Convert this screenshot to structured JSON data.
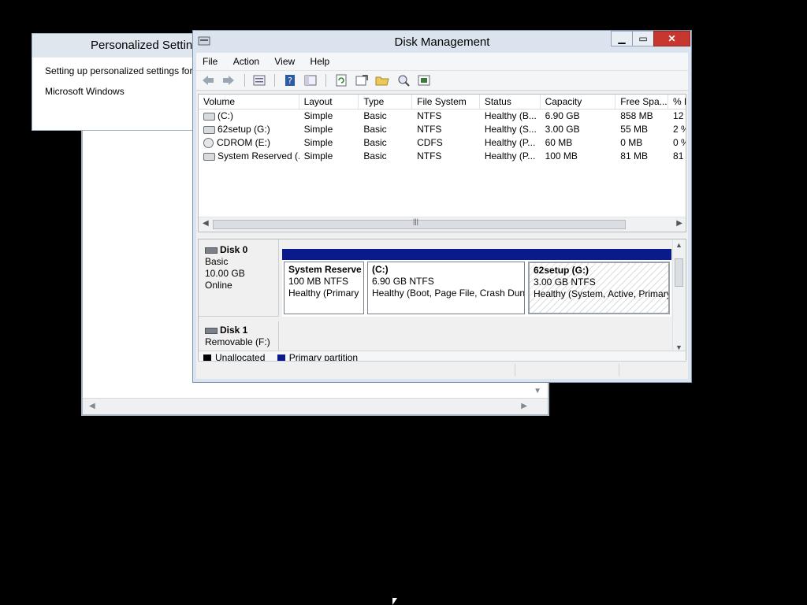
{
  "personalized": {
    "title": "Personalized Settings",
    "line1": "Setting up personalized settings for:",
    "line2": "Microsoft Windows"
  },
  "window": {
    "title": "Disk Management",
    "minimize_icon": "minimize-icon",
    "maximize_icon": "maximize-icon",
    "close_icon": "close-icon"
  },
  "menu": [
    "File",
    "Action",
    "View",
    "Help"
  ],
  "toolbar": [
    "back-icon",
    "forward-icon",
    "properties-icon",
    "help-icon",
    "view-icon",
    "refresh-icon",
    "rescan-icon",
    "open-icon",
    "explore-icon",
    "settings-icon"
  ],
  "volumes": {
    "headers": [
      "Volume",
      "Layout",
      "Type",
      "File System",
      "Status",
      "Capacity",
      "Free Spa...",
      "% F"
    ],
    "rows": [
      {
        "icon": "drive-icon",
        "volume": "(C:)",
        "layout": "Simple",
        "type": "Basic",
        "fs": "NTFS",
        "status": "Healthy (B...",
        "capacity": "6.90 GB",
        "free": "858 MB",
        "pct": "12"
      },
      {
        "icon": "drive-icon",
        "volume": "62setup (G:)",
        "layout": "Simple",
        "type": "Basic",
        "fs": "NTFS",
        "status": "Healthy (S...",
        "capacity": "3.00 GB",
        "free": "55 MB",
        "pct": "2 %"
      },
      {
        "icon": "cd-icon",
        "volume": "CDROM (E:)",
        "layout": "Simple",
        "type": "Basic",
        "fs": "CDFS",
        "status": "Healthy (P...",
        "capacity": "60 MB",
        "free": "0 MB",
        "pct": "0 %"
      },
      {
        "icon": "drive-icon",
        "volume": "System Reserved (...",
        "layout": "Simple",
        "type": "Basic",
        "fs": "NTFS",
        "status": "Healthy (P...",
        "capacity": "100 MB",
        "free": "81 MB",
        "pct": "81"
      }
    ]
  },
  "disk0": {
    "name": "Disk 0",
    "type": "Basic",
    "size": "10.00 GB",
    "state": "Online",
    "partitions": [
      {
        "name": "System Reserve",
        "size": "100 MB NTFS",
        "status": "Healthy (Primary"
      },
      {
        "name": "(C:)",
        "size": "6.90 GB NTFS",
        "status": "Healthy (Boot, Page File, Crash Dun"
      },
      {
        "name": "62setup  (G:)",
        "size": "3.00 GB NTFS",
        "status": "Healthy (System, Active, Primary"
      }
    ]
  },
  "disk1": {
    "name": "Disk 1",
    "type": "Removable (F:)"
  },
  "legend": [
    {
      "label": "Unallocated",
      "color": "#000000"
    },
    {
      "label": "Primary partition",
      "color": "#0a1a8a"
    }
  ]
}
